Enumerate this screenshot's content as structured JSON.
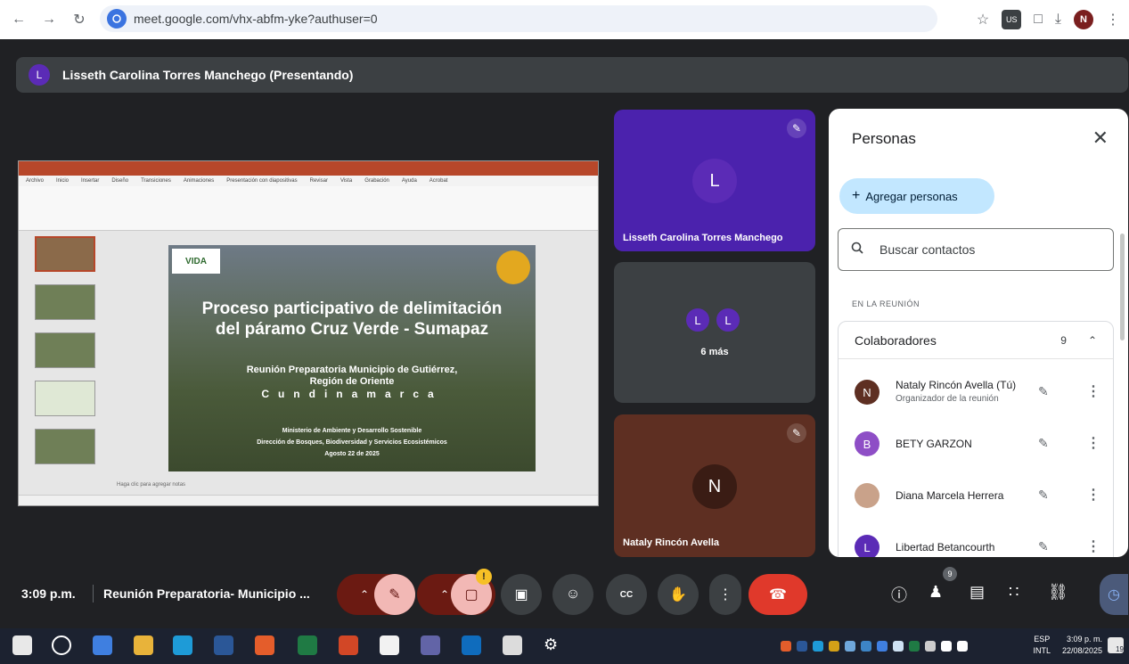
{
  "browser": {
    "url": "meet.google.com/vhx-abfm-yke?authuser=0",
    "profile_initial": "N",
    "extension_badge": "US"
  },
  "presenter": {
    "avatar_initial": "L",
    "label": "Lisseth Carolina Torres Manchego (Presentando)"
  },
  "slide": {
    "logo_line1": "COLOMBIA",
    "logo_line2": "VIDA",
    "title_line1": "Proceso participativo de delimitación",
    "title_line2": "del páramo Cruz Verde - Sumapaz",
    "subtitle_line1": "Reunión Preparatoria Municipio de Gutiérrez,",
    "subtitle_line2": "Región de Oriente",
    "spaced": "Cundinamarca",
    "footer_line1": "Ministerio de Ambiente y Desarrollo Sostenible",
    "footer_line2": "Dirección de Bosques, Biodiversidad y Servicios Ecosistémicos",
    "footer_line3": "Agosto 22 de 2025",
    "ribbon_tabs": [
      "Archivo",
      "Inicio",
      "Insertar",
      "Diseño",
      "Transiciones",
      "Animaciones",
      "Presentación con diapositivas",
      "Revisar",
      "Vista",
      "Grabación",
      "Ayuda",
      "Acrobat"
    ],
    "notes_hint": "Haga clic para agregar notas"
  },
  "tiles": [
    {
      "initial": "L",
      "name": "Lisseth Carolina Torres Manchego",
      "muted": true,
      "color": "#4b22ad"
    },
    {
      "initials": [
        "L",
        "L"
      ],
      "more": "6 más"
    },
    {
      "initial": "N",
      "name": "Nataly Rincón Avella",
      "muted": true,
      "color": "#5e2f22"
    }
  ],
  "panel": {
    "title": "Personas",
    "add_label": "Agregar personas",
    "search_placeholder": "Buscar contactos",
    "section_label": "EN LA REUNIÓN",
    "group_title": "Colaboradores",
    "group_count": "9",
    "people": [
      {
        "initial": "N",
        "name": "Nataly Rincón Avella (Tú)",
        "subtitle": "Organizador de la reunión",
        "avatar_color": "#5e2f22"
      },
      {
        "initial": "B",
        "name": "BETY GARZON",
        "subtitle": "",
        "avatar_color": "#8e4ec6"
      },
      {
        "initial": "",
        "name": "Diana Marcela Herrera",
        "subtitle": "",
        "avatar_color": "#c9a28a"
      },
      {
        "initial": "L",
        "name": "Libertad Betancourth",
        "subtitle": "",
        "avatar_color": "#5b2bb6"
      }
    ]
  },
  "meeting_bar": {
    "time": "3:09 p.m.",
    "meeting_name": "Reunión Preparatoria- Municipio ...",
    "alert_count": "!",
    "people_count": "9"
  },
  "taskbar": {
    "lang_line1": "ESP",
    "lang_line2": "INTL",
    "time": "3:09 p. m.",
    "date": "22/08/2025",
    "notification_count": "19"
  }
}
